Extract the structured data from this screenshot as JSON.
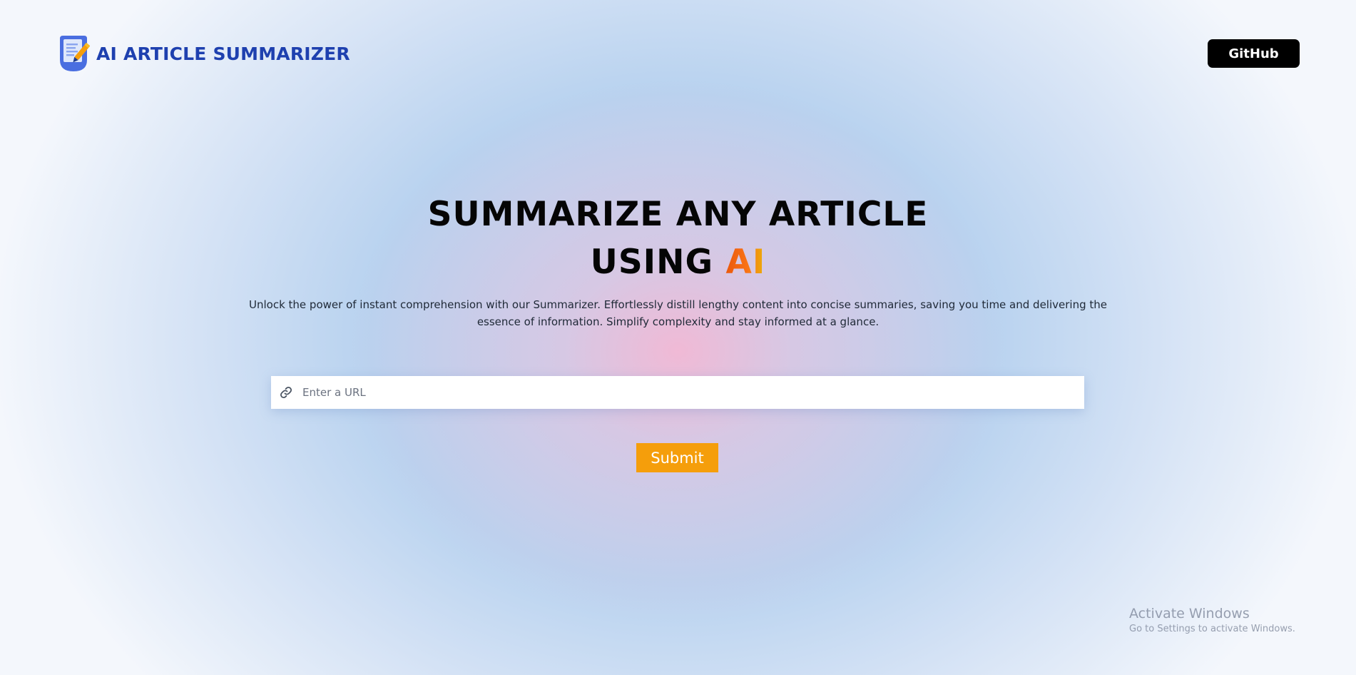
{
  "header": {
    "logo_text": "AI ARTICLE SUMMARIZER",
    "github_label": "GitHub"
  },
  "hero": {
    "title_line1": "SUMMARIZE ANY ARTICLE",
    "title_line2_prefix": "USING",
    "title_line2_accent": "AI",
    "description": "Unlock the power of instant comprehension with our Summarizer. Effortlessly distill lengthy content into concise summaries, saving you time and delivering the essence of information. Simplify complexity and stay informed at a glance."
  },
  "form": {
    "url_placeholder": "Enter a URL",
    "url_value": "",
    "submit_label": "Submit"
  },
  "icons": {
    "logo": "document-pencil-icon",
    "url": "link-icon"
  },
  "watermark": {
    "title": "Activate Windows",
    "subtitle": "Go to Settings to activate Windows."
  },
  "colors": {
    "brand": "#1e40af",
    "accent": "#f59e0b",
    "github_bg": "#000000"
  }
}
